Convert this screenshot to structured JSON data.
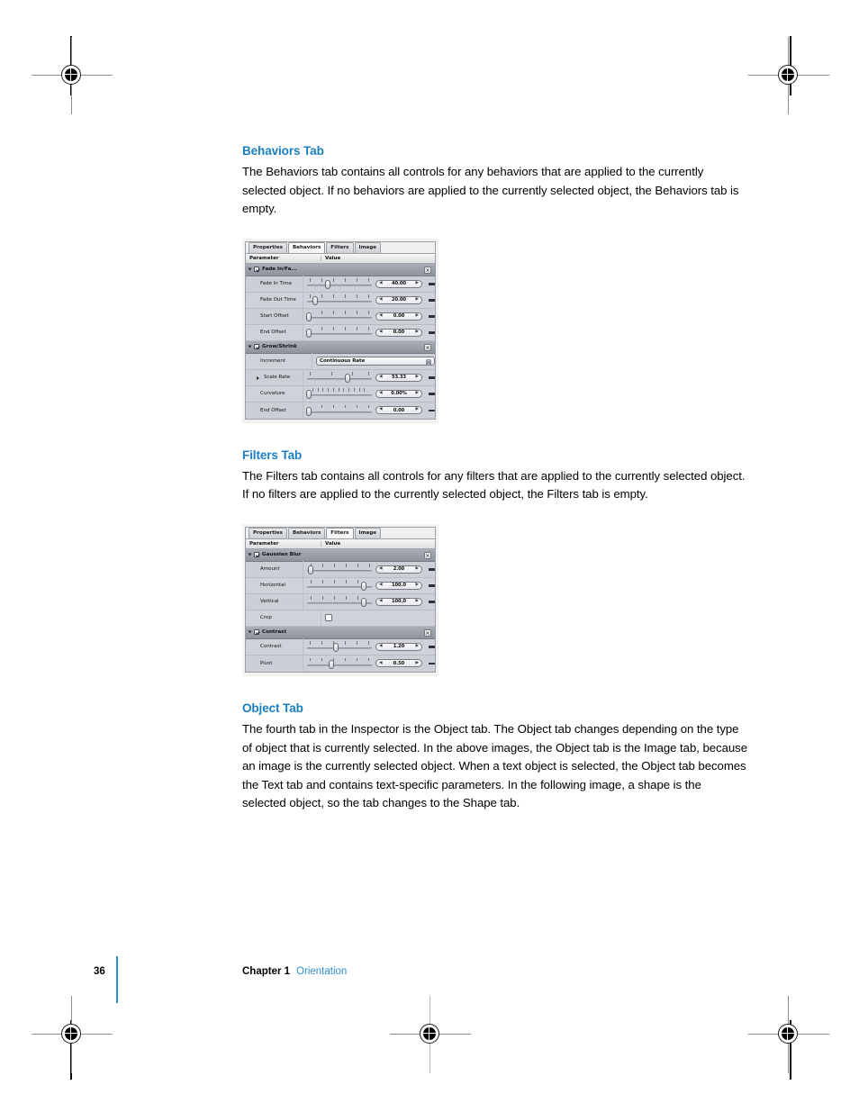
{
  "page": {
    "number": "36",
    "chapter": "Chapter 1",
    "section": "Orientation",
    "accent_blue": "#1a7fc1",
    "rule_blue": "#2e8ccf"
  },
  "sections": [
    {
      "heading": "Behaviors Tab",
      "body": "The Behaviors tab contains all controls for any behaviors that are applied to the currently selected object. If no behaviors are applied to the currently selected object, the Behaviors tab is empty."
    },
    {
      "heading": "Filters Tab",
      "body": "The Filters tab contains all controls for any filters that are applied to the currently selected object. If no filters are applied to the currently selected object, the Filters tab is empty."
    },
    {
      "heading": "Object Tab",
      "body": "The fourth tab in the Inspector is the Object tab. The Object tab changes depending on the type of object that is currently selected. In the above images, the Object tab is the Image tab, because an image is the currently selected object. When a text object is selected, the Object tab becomes the Text tab and contains text-specific parameters. In the following image, a shape is the selected object, so the tab changes to the Shape tab."
    }
  ],
  "figures": [
    {
      "name": "behaviors-inspector",
      "tabs": [
        {
          "label": "Properties",
          "active": false
        },
        {
          "label": "Behaviors",
          "active": true
        },
        {
          "label": "Filters",
          "active": false
        },
        {
          "label": "Image",
          "active": false
        }
      ],
      "columns": [
        "Parameter",
        "Value"
      ],
      "groups": [
        {
          "title": "Fade In/Fa...",
          "checked": true,
          "close_label": "×",
          "rows": [
            {
              "label": "Fade In Time",
              "control": "slider",
              "value": "40.00",
              "knob_pct": 32,
              "ticks": 5,
              "has_dash": true
            },
            {
              "label": "Fade Out Time",
              "control": "slider",
              "value": "20.00",
              "knob_pct": 12,
              "ticks": 5,
              "has_dash": true
            },
            {
              "label": "Start Offset",
              "control": "slider",
              "value": "0.00",
              "knob_pct": 1,
              "ticks": 5,
              "has_dash": true
            },
            {
              "label": "End Offset",
              "control": "slider",
              "value": "0.00",
              "knob_pct": 1,
              "ticks": 5,
              "has_dash": true
            }
          ]
        },
        {
          "title": "Grow/Shrink",
          "checked": true,
          "close_label": "×",
          "rows": [
            {
              "label": "Increment",
              "control": "popup",
              "value": "Continuous Rate"
            },
            {
              "label": "Scale Rate",
              "control": "slider",
              "value": "53.33",
              "knob_pct": 62,
              "ticks": 3,
              "has_dash": true,
              "disclosure": true
            },
            {
              "label": "Curvature",
              "control": "slider",
              "value": "0.00%",
              "knob_pct": 1,
              "ticks": 11,
              "has_dash": true
            },
            {
              "label": "End Offset",
              "control": "slider",
              "value": "0.00",
              "knob_pct": 1,
              "ticks": 5,
              "has_dash": true
            }
          ]
        }
      ]
    },
    {
      "name": "filters-inspector",
      "tabs": [
        {
          "label": "Properties",
          "active": false
        },
        {
          "label": "Behaviors",
          "active": false
        },
        {
          "label": "Filters",
          "active": true
        },
        {
          "label": "Image",
          "active": false
        }
      ],
      "columns": [
        "Parameter",
        "Value"
      ],
      "groups": [
        {
          "title": "Gaussian Blur",
          "checked": true,
          "close_label": "×",
          "rows": [
            {
              "label": "Amount",
              "control": "slider",
              "value": "2.00",
              "knob_pct": 4,
              "ticks": 5,
              "has_dash": true
            },
            {
              "label": "Horizontal",
              "control": "slider",
              "value": "100.0",
              "knob_pct": 88,
              "ticks": 5,
              "has_dash": true
            },
            {
              "label": "Vertical",
              "control": "slider",
              "value": "100.0",
              "knob_pct": 88,
              "ticks": 5,
              "has_dash": true
            },
            {
              "label": "Crop",
              "control": "checkbox",
              "value": ""
            }
          ]
        },
        {
          "title": "Contrast",
          "checked": true,
          "close_label": "×",
          "rows": [
            {
              "label": "Contrast",
              "control": "slider",
              "value": "1.20",
              "knob_pct": 44,
              "ticks": 5,
              "has_dash": true
            },
            {
              "label": "Pivot",
              "control": "slider",
              "value": "0.50",
              "knob_pct": 38,
              "ticks": 5,
              "has_dash": true
            }
          ]
        }
      ]
    }
  ]
}
